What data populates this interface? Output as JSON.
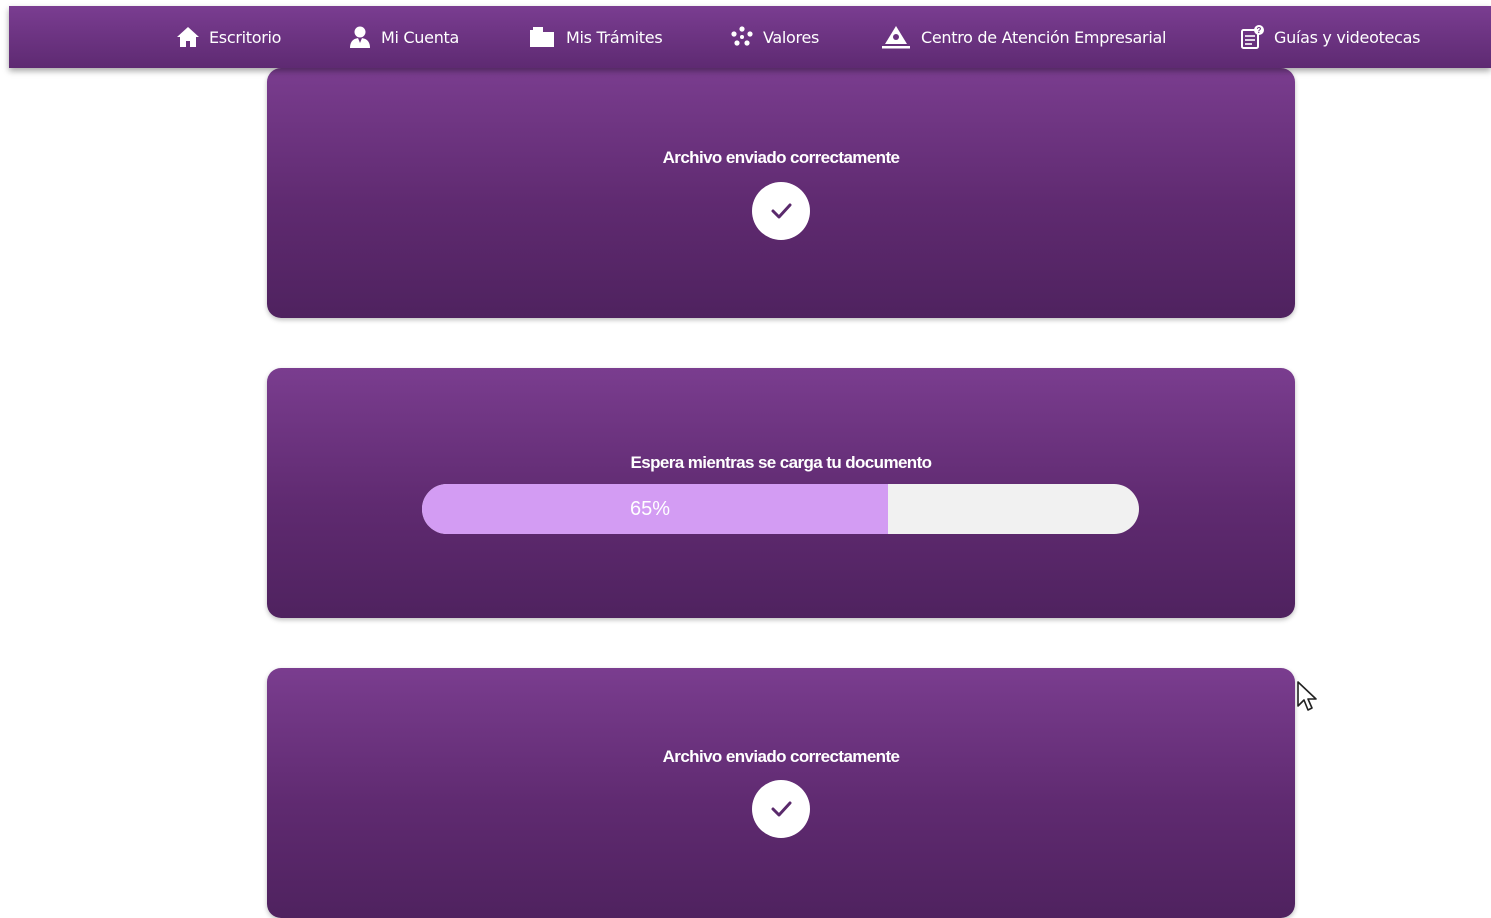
{
  "nav": {
    "items": [
      {
        "label": "Escritorio",
        "icon": "home-icon"
      },
      {
        "label": "Mi Cuenta",
        "icon": "user-icon"
      },
      {
        "label": "Mis Trámites",
        "icon": "folder-icon"
      },
      {
        "label": "Valores",
        "icon": "values-icon"
      },
      {
        "label": "Centro de Atención Empresarial",
        "icon": "business-center-icon"
      },
      {
        "label": "Guías y videotecas",
        "icon": "guides-icon"
      }
    ]
  },
  "cards": {
    "first": {
      "title": "Archivo enviado correctamente",
      "icon": "check-icon"
    },
    "upload": {
      "title": "Espera mientras se carga tu documento",
      "progress_percent": 65,
      "progress_text": "65%"
    },
    "third": {
      "title": "Archivo enviado correctamente",
      "icon": "check-icon"
    }
  },
  "colors": {
    "header": "#6b3380",
    "card": "#6a3380",
    "progress_fill": "#d39cf3",
    "progress_track": "#f1f1f1"
  }
}
